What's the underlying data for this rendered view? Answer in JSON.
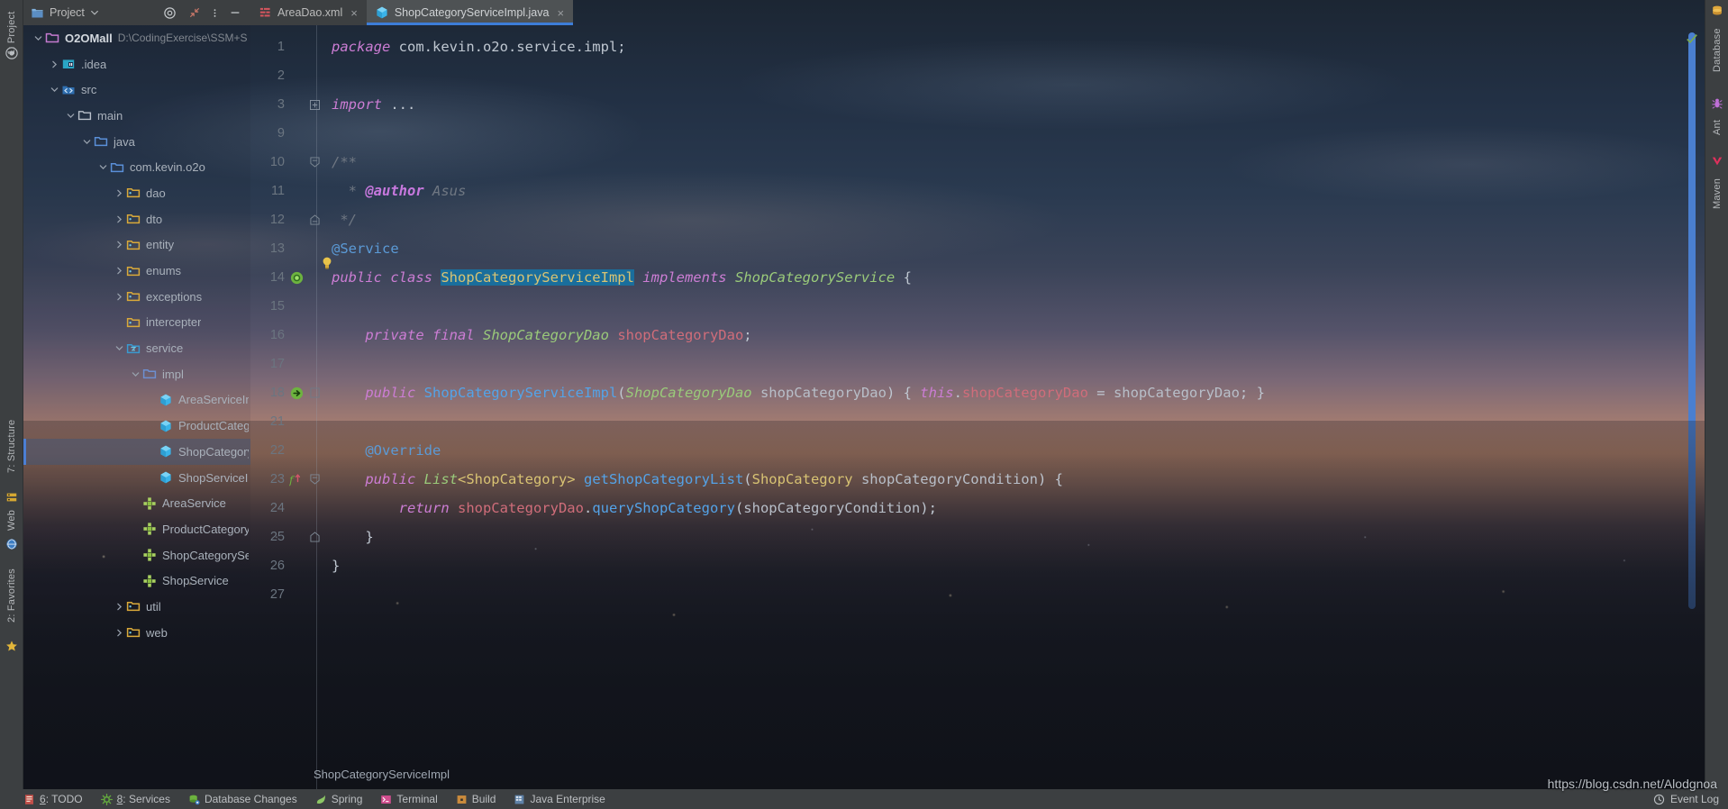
{
  "window": {
    "project_tool_label": "1: Project",
    "left_rail": [
      {
        "label": "1: Project",
        "icon": "project-icon"
      },
      {
        "label": "7: Structure",
        "icon": "structure-icon"
      },
      {
        "label": "Web",
        "icon": "web-icon"
      },
      {
        "label": "2: Favorites",
        "icon": "favorites-star-icon"
      }
    ],
    "right_rail": [
      {
        "label": "Database",
        "icon": "database-icon"
      },
      {
        "label": "Ant",
        "icon": "ant-bug-icon"
      },
      {
        "label": "Maven",
        "icon": "maven-icon"
      }
    ]
  },
  "toolbar": {
    "project_label": "Project",
    "dropdown_icon": "chevron-down-icon",
    "locate_icon": "target-locate-icon",
    "collapse_icon": "collapse-all-icon",
    "options_icon": "more-vertical-icon",
    "hide_icon": "minimize-icon"
  },
  "tabs": [
    {
      "label": "AreaDao.xml",
      "icon": "xml-file-icon",
      "active": false,
      "closable": true,
      "close_label": "×"
    },
    {
      "label": "ShopCategoryServiceImpl.java",
      "icon": "java-class-icon",
      "active": true,
      "closable": true,
      "close_label": "×"
    }
  ],
  "tree": [
    {
      "label": "O2OMall",
      "path": "D:\\CodingExercise\\SSM+S",
      "indent": 0,
      "arrow": "down",
      "icon": "module-folder-icon",
      "bold": true,
      "selected": false
    },
    {
      "label": ".idea",
      "indent": 1,
      "arrow": "right",
      "icon": "idea-folder-icon",
      "selected": false
    },
    {
      "label": "src",
      "indent": 1,
      "arrow": "down",
      "icon": "source-folder-icon",
      "selected": false
    },
    {
      "label": "main",
      "indent": 2,
      "arrow": "down",
      "icon": "folder-icon",
      "selected": false
    },
    {
      "label": "java",
      "indent": 3,
      "arrow": "down",
      "icon": "source-root-icon",
      "selected": false
    },
    {
      "label": "com.kevin.o2o",
      "indent": 4,
      "arrow": "down",
      "icon": "package-icon",
      "selected": false
    },
    {
      "label": "dao",
      "indent": 5,
      "arrow": "right",
      "icon": "package-yellow-icon",
      "selected": false
    },
    {
      "label": "dto",
      "indent": 5,
      "arrow": "right",
      "icon": "package-yellow-icon",
      "selected": false
    },
    {
      "label": "entity",
      "indent": 5,
      "arrow": "right",
      "icon": "package-yellow-icon",
      "selected": false
    },
    {
      "label": "enums",
      "indent": 5,
      "arrow": "right",
      "icon": "package-yellow-icon",
      "selected": false
    },
    {
      "label": "exceptions",
      "indent": 5,
      "arrow": "right",
      "icon": "package-yellow-icon",
      "selected": false
    },
    {
      "label": "intercepter",
      "indent": 5,
      "arrow": "none",
      "icon": "package-yellow-icon",
      "selected": false
    },
    {
      "label": "service",
      "indent": 5,
      "arrow": "down",
      "icon": "package-blue-icon",
      "selected": false
    },
    {
      "label": "impl",
      "indent": 6,
      "arrow": "down",
      "icon": "folder-outline-icon",
      "selected": false
    },
    {
      "label": "AreaServiceImpl",
      "indent": 7,
      "arrow": "none",
      "icon": "java-class-icon",
      "selected": false
    },
    {
      "label": "ProductCategoryServiceImpl",
      "indent": 7,
      "arrow": "none",
      "icon": "java-class-icon",
      "selected": false
    },
    {
      "label": "ShopCategoryServiceImpl",
      "indent": 7,
      "arrow": "none",
      "icon": "java-class-icon",
      "selected": true
    },
    {
      "label": "ShopServiceImpl",
      "indent": 7,
      "arrow": "none",
      "icon": "java-class-icon",
      "selected": false
    },
    {
      "label": "AreaService",
      "indent": 6,
      "arrow": "none",
      "icon": "java-interface-icon",
      "selected": false
    },
    {
      "label": "ProductCategoryService",
      "indent": 6,
      "arrow": "none",
      "icon": "java-interface-icon",
      "selected": false
    },
    {
      "label": "ShopCategoryService",
      "indent": 6,
      "arrow": "none",
      "icon": "java-interface-icon",
      "selected": false
    },
    {
      "label": "ShopService",
      "indent": 6,
      "arrow": "none",
      "icon": "java-interface-icon",
      "selected": false
    },
    {
      "label": "util",
      "indent": 5,
      "arrow": "right",
      "icon": "package-yellow-icon",
      "selected": false
    },
    {
      "label": "web",
      "indent": 5,
      "arrow": "right",
      "icon": "package-yellow-icon",
      "selected": false
    }
  ],
  "editor": {
    "file": "ShopCategoryServiceImpl.java",
    "selected_text": "ShopCategoryServiceImpl",
    "lines": [
      {
        "num": "1",
        "mark": "none",
        "fold": "none"
      },
      {
        "num": "2",
        "mark": "none",
        "fold": "none"
      },
      {
        "num": "3",
        "mark": "none",
        "fold": "plus"
      },
      {
        "num": "9",
        "mark": "none",
        "fold": "none"
      },
      {
        "num": "10",
        "mark": "none",
        "fold": "doc-top"
      },
      {
        "num": "11",
        "mark": "none",
        "fold": "none"
      },
      {
        "num": "12",
        "mark": "none",
        "fold": "doc-bottom"
      },
      {
        "num": "13",
        "mark": "bulb",
        "fold": "none"
      },
      {
        "num": "14",
        "mark": "bean",
        "fold": "none"
      },
      {
        "num": "15",
        "mark": "none",
        "fold": "none"
      },
      {
        "num": "16",
        "mark": "none",
        "fold": "none"
      },
      {
        "num": "17",
        "mark": "none",
        "fold": "none"
      },
      {
        "num": "18",
        "mark": "bean-arrow",
        "fold": "block"
      },
      {
        "num": "21",
        "mark": "none",
        "fold": "none"
      },
      {
        "num": "22",
        "mark": "none",
        "fold": "none"
      },
      {
        "num": "23",
        "mark": "override",
        "fold": "minus"
      },
      {
        "num": "24",
        "mark": "none",
        "fold": "none"
      },
      {
        "num": "25",
        "mark": "none",
        "fold": "end"
      },
      {
        "num": "26",
        "mark": "none",
        "fold": "none"
      },
      {
        "num": "27",
        "mark": "none",
        "fold": "none"
      }
    ],
    "code_text": {
      "l1": "package com.kevin.o2o.service.impl;",
      "l3": "import ...",
      "l10": "/**",
      "l11_tag": "@author",
      "l11_val": "Asus",
      "l12": "*/",
      "l13": "@Service",
      "l14": "public class ShopCategoryServiceImpl implements ShopCategoryService {",
      "l16": "private final ShopCategoryDao shopCategoryDao;",
      "l18": "public ShopCategoryServiceImpl(ShopCategoryDao shopCategoryDao) { this.shopCategoryDao = shopCategoryDao; }",
      "l22": "@Override",
      "l23": "public List<ShopCategory> getShopCategoryList(ShopCategory shopCategoryCondition) {",
      "l24": "return shopCategoryDao.queryShopCategory(shopCategoryCondition);",
      "l25": "}",
      "l26": "}"
    }
  },
  "breadcrumb": {
    "text": "ShopCategoryServiceImpl"
  },
  "statusbar": {
    "items": [
      {
        "label_prefix": "6",
        "label": ": TODO",
        "icon": "todo-icon"
      },
      {
        "label_prefix": "8",
        "label": ": Services",
        "icon": "services-gear-icon"
      },
      {
        "label_prefix": "",
        "label": "Database Changes",
        "icon": "database-changes-icon"
      },
      {
        "label_prefix": "",
        "label": "Spring",
        "icon": "spring-leaf-icon"
      },
      {
        "label_prefix": "",
        "label": "Terminal",
        "icon": "terminal-icon"
      },
      {
        "label_prefix": "",
        "label": "Build",
        "icon": "build-icon"
      },
      {
        "label_prefix": "",
        "label": "Java Enterprise",
        "icon": "java-enterprise-icon"
      }
    ],
    "event_log": "Event Log",
    "event_log_icon": "event-log-icon"
  },
  "watermark": {
    "text": "https://blog.csdn.net/Alodgnoa"
  },
  "colors": {
    "accent_blue": "#4a7fd0",
    "tab_active_bg": "#4e5254",
    "toolbar_bg": "#3c3f41",
    "selection": "#1a6e9c",
    "keyword": "#cc7dd4",
    "type": "#9aca7a",
    "method": "#54a3e8",
    "annotation": "#5b9ad6",
    "field": "#d06d7a"
  }
}
